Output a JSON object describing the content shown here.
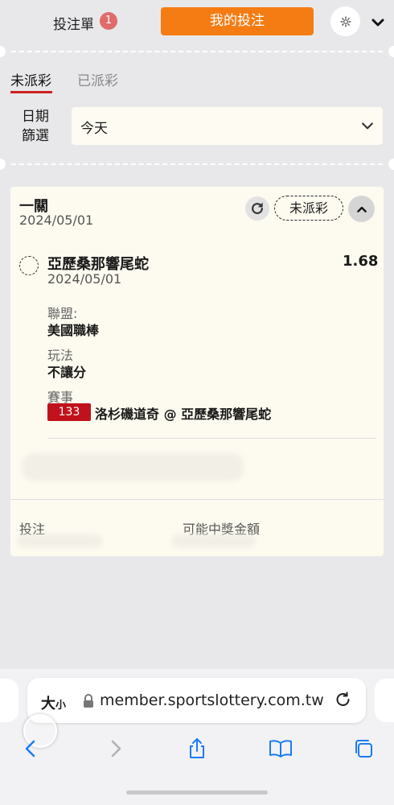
{
  "header": {
    "betslip_label": "投注單",
    "betslip_count": "1",
    "my_bets_label": "我的投注"
  },
  "filter": {
    "tabs": [
      {
        "label": "未派彩",
        "active": true
      },
      {
        "label": "已派彩",
        "active": false
      }
    ],
    "date_label": "日期篩選",
    "date_value": "今天"
  },
  "bet": {
    "type": "一關",
    "date": "2024/05/01",
    "status": "未派彩",
    "selection": {
      "name": "亞歷桑那響尾蛇",
      "odds": "1.68",
      "date": "2024/05/01",
      "league_label": "聯盟:",
      "league": "美國職棒",
      "market_label": "玩法",
      "market": "不讓分",
      "event_label": "賽事",
      "event_number": "133",
      "event_name": "洛杉磯道奇 @ 亞歷桑那響尾蛇"
    },
    "stake_label": "投注",
    "potential_win_label": "可能中獎金額"
  },
  "browser": {
    "text_size_big": "大",
    "text_size_small": "小",
    "url": "member.sportslottery.com.tw"
  },
  "colors": {
    "accent_orange": "#f57c12",
    "tab_underline": "#cc2222",
    "event_badge": "#c0121c",
    "ios_blue": "#1a7cf5"
  }
}
